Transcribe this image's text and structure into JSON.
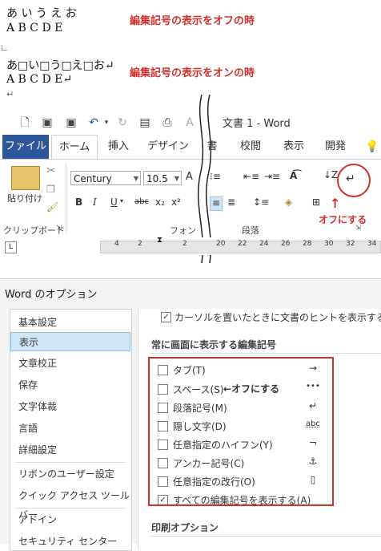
{
  "samples": {
    "off_line1": "あ い う え お",
    "off_line2": "A B C D E",
    "off_note": "編集記号の表示をオフの時",
    "on_line1": "あ□い□う□え□お↵",
    "on_line2": "A B C D E↵",
    "on_line3": "↵",
    "on_note": "編集記号の表示をオンの時"
  },
  "word": {
    "title": "文書 1 - Word",
    "tabs": [
      "ファイル",
      "ホーム",
      "挿入",
      "デザイン",
      "書",
      "校閲",
      "表示",
      "開発"
    ],
    "clipboard": {
      "paste_label": "貼り付け",
      "group_label": "クリップボード"
    },
    "font": {
      "name": "Century",
      "size": "10.5",
      "group_label": "フォン"
    },
    "paragraph": {
      "group_label": "段落"
    },
    "annotation": "オフにする",
    "ruler_ticks": [
      "4",
      "2",
      "2",
      "20",
      "22",
      "24",
      "26",
      "28",
      "30",
      "32",
      "34"
    ]
  },
  "options": {
    "title": "Word のオプション",
    "nav": [
      "基本設定",
      "表示",
      "文章校正",
      "保存",
      "文字体裁",
      "言語",
      "詳細設定",
      "リボンのユーザー設定",
      "クイック アクセス ツール バー",
      "アドイン",
      "セキュリティ センター"
    ],
    "selected_nav": "表示",
    "top_option": "カーソルを置いたときに文書のヒントを表示する(L)",
    "section_marks": "常に画面に表示する編集記号",
    "marks": [
      {
        "label": "タブ(T)",
        "symbol": "→",
        "checked": false
      },
      {
        "label": "スペース(S)",
        "symbol": "•••",
        "checked": false
      },
      {
        "label": "段落記号(M)",
        "symbol": "↵",
        "checked": false
      },
      {
        "label": "隠し文字(D)",
        "symbol": "abc",
        "checked": false
      },
      {
        "label": "任意指定のハイフン(Y)",
        "symbol": "¬",
        "checked": false
      },
      {
        "label": "アンカー記号(C)",
        "symbol": "⚓",
        "checked": false
      },
      {
        "label": "任意指定の改行(O)",
        "symbol": "▯",
        "checked": false
      },
      {
        "label": "すべての編集記号を表示する(A)",
        "symbol": "",
        "checked": true
      }
    ],
    "space_annotation": "←オフにする",
    "section_print": "印刷オプション"
  },
  "colors": {
    "accent_red": "#d0312d",
    "word_blue": "#2b579a",
    "nav_selected": "#cde6f7"
  }
}
